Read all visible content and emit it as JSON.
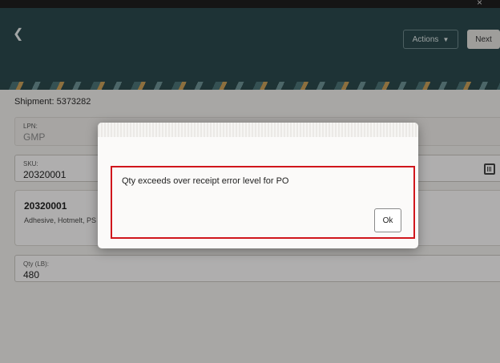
{
  "header": {
    "back_icon": "chevron-left-icon",
    "actions_label": "Actions",
    "actions_caret_icon": "caret-down-icon",
    "next_label": "Next",
    "close_glyph": "×"
  },
  "shipment": {
    "label": "Shipment: 5373282"
  },
  "fields": {
    "lpn": {
      "label": "LPN:",
      "value": "GMP"
    },
    "sku": {
      "label": "SKU:",
      "value": "20320001",
      "scan_icon": "barcode-scan-icon"
    },
    "item": {
      "code": "20320001",
      "description": "Adhesive, Hotmelt, PS"
    },
    "qty": {
      "label": "Qty (LB):",
      "value": "480"
    }
  },
  "dialog": {
    "message": "Qty exceeds over receipt error level for PO",
    "ok_label": "Ok"
  },
  "colors": {
    "header_bg": "#2c4a4e",
    "highlight_border": "#d0161c",
    "overlay": "rgba(0,0,0,0.30)"
  }
}
